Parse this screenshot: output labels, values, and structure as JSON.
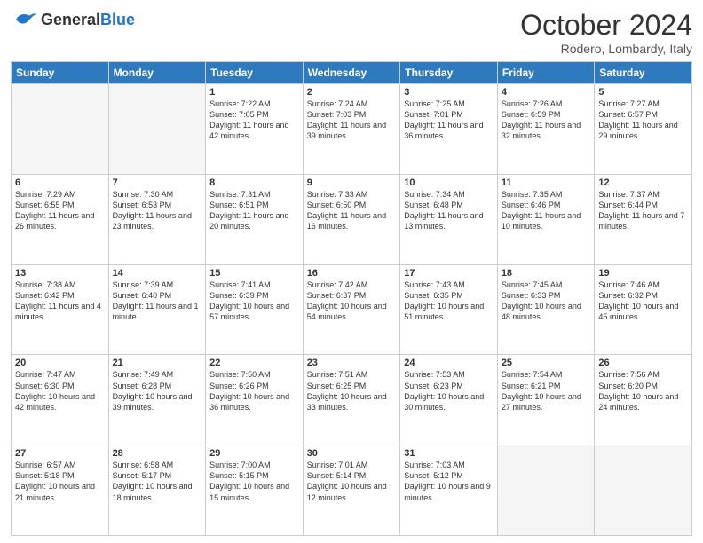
{
  "header": {
    "logo_general": "General",
    "logo_blue": "Blue",
    "month": "October 2024",
    "location": "Rodero, Lombardy, Italy"
  },
  "calendar": {
    "days_of_week": [
      "Sunday",
      "Monday",
      "Tuesday",
      "Wednesday",
      "Thursday",
      "Friday",
      "Saturday"
    ],
    "weeks": [
      [
        {
          "day": "",
          "sunrise": "",
          "sunset": "",
          "daylight": ""
        },
        {
          "day": "",
          "sunrise": "",
          "sunset": "",
          "daylight": ""
        },
        {
          "day": "1",
          "sunrise": "Sunrise: 7:22 AM",
          "sunset": "Sunset: 7:05 PM",
          "daylight": "Daylight: 11 hours and 42 minutes."
        },
        {
          "day": "2",
          "sunrise": "Sunrise: 7:24 AM",
          "sunset": "Sunset: 7:03 PM",
          "daylight": "Daylight: 11 hours and 39 minutes."
        },
        {
          "day": "3",
          "sunrise": "Sunrise: 7:25 AM",
          "sunset": "Sunset: 7:01 PM",
          "daylight": "Daylight: 11 hours and 36 minutes."
        },
        {
          "day": "4",
          "sunrise": "Sunrise: 7:26 AM",
          "sunset": "Sunset: 6:59 PM",
          "daylight": "Daylight: 11 hours and 32 minutes."
        },
        {
          "day": "5",
          "sunrise": "Sunrise: 7:27 AM",
          "sunset": "Sunset: 6:57 PM",
          "daylight": "Daylight: 11 hours and 29 minutes."
        }
      ],
      [
        {
          "day": "6",
          "sunrise": "Sunrise: 7:29 AM",
          "sunset": "Sunset: 6:55 PM",
          "daylight": "Daylight: 11 hours and 26 minutes."
        },
        {
          "day": "7",
          "sunrise": "Sunrise: 7:30 AM",
          "sunset": "Sunset: 6:53 PM",
          "daylight": "Daylight: 11 hours and 23 minutes."
        },
        {
          "day": "8",
          "sunrise": "Sunrise: 7:31 AM",
          "sunset": "Sunset: 6:51 PM",
          "daylight": "Daylight: 11 hours and 20 minutes."
        },
        {
          "day": "9",
          "sunrise": "Sunrise: 7:33 AM",
          "sunset": "Sunset: 6:50 PM",
          "daylight": "Daylight: 11 hours and 16 minutes."
        },
        {
          "day": "10",
          "sunrise": "Sunrise: 7:34 AM",
          "sunset": "Sunset: 6:48 PM",
          "daylight": "Daylight: 11 hours and 13 minutes."
        },
        {
          "day": "11",
          "sunrise": "Sunrise: 7:35 AM",
          "sunset": "Sunset: 6:46 PM",
          "daylight": "Daylight: 11 hours and 10 minutes."
        },
        {
          "day": "12",
          "sunrise": "Sunrise: 7:37 AM",
          "sunset": "Sunset: 6:44 PM",
          "daylight": "Daylight: 11 hours and 7 minutes."
        }
      ],
      [
        {
          "day": "13",
          "sunrise": "Sunrise: 7:38 AM",
          "sunset": "Sunset: 6:42 PM",
          "daylight": "Daylight: 11 hours and 4 minutes."
        },
        {
          "day": "14",
          "sunrise": "Sunrise: 7:39 AM",
          "sunset": "Sunset: 6:40 PM",
          "daylight": "Daylight: 11 hours and 1 minute."
        },
        {
          "day": "15",
          "sunrise": "Sunrise: 7:41 AM",
          "sunset": "Sunset: 6:39 PM",
          "daylight": "Daylight: 10 hours and 57 minutes."
        },
        {
          "day": "16",
          "sunrise": "Sunrise: 7:42 AM",
          "sunset": "Sunset: 6:37 PM",
          "daylight": "Daylight: 10 hours and 54 minutes."
        },
        {
          "day": "17",
          "sunrise": "Sunrise: 7:43 AM",
          "sunset": "Sunset: 6:35 PM",
          "daylight": "Daylight: 10 hours and 51 minutes."
        },
        {
          "day": "18",
          "sunrise": "Sunrise: 7:45 AM",
          "sunset": "Sunset: 6:33 PM",
          "daylight": "Daylight: 10 hours and 48 minutes."
        },
        {
          "day": "19",
          "sunrise": "Sunrise: 7:46 AM",
          "sunset": "Sunset: 6:32 PM",
          "daylight": "Daylight: 10 hours and 45 minutes."
        }
      ],
      [
        {
          "day": "20",
          "sunrise": "Sunrise: 7:47 AM",
          "sunset": "Sunset: 6:30 PM",
          "daylight": "Daylight: 10 hours and 42 minutes."
        },
        {
          "day": "21",
          "sunrise": "Sunrise: 7:49 AM",
          "sunset": "Sunset: 6:28 PM",
          "daylight": "Daylight: 10 hours and 39 minutes."
        },
        {
          "day": "22",
          "sunrise": "Sunrise: 7:50 AM",
          "sunset": "Sunset: 6:26 PM",
          "daylight": "Daylight: 10 hours and 36 minutes."
        },
        {
          "day": "23",
          "sunrise": "Sunrise: 7:51 AM",
          "sunset": "Sunset: 6:25 PM",
          "daylight": "Daylight: 10 hours and 33 minutes."
        },
        {
          "day": "24",
          "sunrise": "Sunrise: 7:53 AM",
          "sunset": "Sunset: 6:23 PM",
          "daylight": "Daylight: 10 hours and 30 minutes."
        },
        {
          "day": "25",
          "sunrise": "Sunrise: 7:54 AM",
          "sunset": "Sunset: 6:21 PM",
          "daylight": "Daylight: 10 hours and 27 minutes."
        },
        {
          "day": "26",
          "sunrise": "Sunrise: 7:56 AM",
          "sunset": "Sunset: 6:20 PM",
          "daylight": "Daylight: 10 hours and 24 minutes."
        }
      ],
      [
        {
          "day": "27",
          "sunrise": "Sunrise: 6:57 AM",
          "sunset": "Sunset: 5:18 PM",
          "daylight": "Daylight: 10 hours and 21 minutes."
        },
        {
          "day": "28",
          "sunrise": "Sunrise: 6:58 AM",
          "sunset": "Sunset: 5:17 PM",
          "daylight": "Daylight: 10 hours and 18 minutes."
        },
        {
          "day": "29",
          "sunrise": "Sunrise: 7:00 AM",
          "sunset": "Sunset: 5:15 PM",
          "daylight": "Daylight: 10 hours and 15 minutes."
        },
        {
          "day": "30",
          "sunrise": "Sunrise: 7:01 AM",
          "sunset": "Sunset: 5:14 PM",
          "daylight": "Daylight: 10 hours and 12 minutes."
        },
        {
          "day": "31",
          "sunrise": "Sunrise: 7:03 AM",
          "sunset": "Sunset: 5:12 PM",
          "daylight": "Daylight: 10 hours and 9 minutes."
        },
        {
          "day": "",
          "sunrise": "",
          "sunset": "",
          "daylight": ""
        },
        {
          "day": "",
          "sunrise": "",
          "sunset": "",
          "daylight": ""
        }
      ]
    ]
  }
}
